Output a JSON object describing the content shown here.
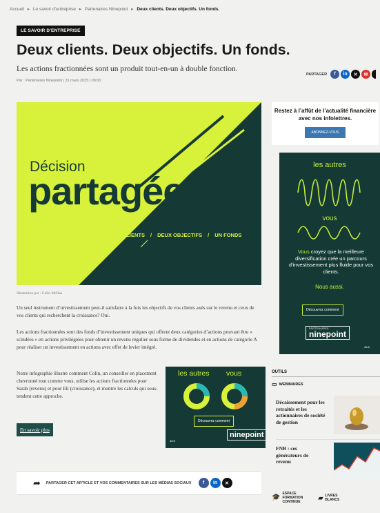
{
  "breadcrumb": {
    "items": [
      "Accueil",
      "Le savoir d’entreprise",
      "Partenaires Ninepoint"
    ],
    "current": "Deux clients. Deux objectifs. Un fonds."
  },
  "article": {
    "category": "LE SAVOIR D’ENTREPRISE",
    "title": "Deux clients. Deux objectifs. Un fonds.",
    "subtitle": "Les actions fractionnées sont un produit tout-en-un à double fonction.",
    "meta": "Par : Partenaires Ninepoint  |  31 mars 2025  |  08:00",
    "share_label": "PARTAGER",
    "caption": "Illustration par : Colin McRae",
    "paragraphs": [
      "Un seul instrument d’investissement peut-il satisfaire à la fois les objectifs de vos clients axés sur le revenu et ceux de vos clients qui recherchent la croissance? Oui.",
      "Les actions fractionnées sont des fonds d’investissement uniques qui offrent deux catégories d’actions pouvant être « scindées » en actions privilégiées pour obtenir un revenu régulier sous forme de dividendes et en actions de catégorie A pour réaliser un investissement en actions avec effet de levier intégré.",
      "Notre infographie illustre comment Colin, un conseiller en placement chevronné tout comme vous, utilise les actions fractionnées pour Sarah (revenu) et pour Eli (croissance), et montre les calculs qui sous-tendent cette approche."
    ],
    "more_button": "En savoir plus",
    "share_bar": "PARTAGER CET ARTICLE ET VOS COMMENTAIRES SUR LES MÉDIAS SOCIAUX"
  },
  "hero": {
    "word1": "Décision",
    "word2": "partagée",
    "tags": [
      "DEUX CLIENTS",
      "DEUX OBJECTIFS",
      "UN FONDS"
    ]
  },
  "newsletter": {
    "text": "Restez à l’affût de l’actualité financière avec nos infolettres.",
    "button": "ABONNEZ-VOUS"
  },
  "ad_main": {
    "top": "les autres",
    "mid": "vous",
    "body_highlight": "Vous",
    "body": " croyez que la meilleure diversification crée un parcours d’investissement plus fluide pour vos clients.",
    "also": "Nous aussi.",
    "button": "Découvrez comment",
    "brand_small": "PARTENAIRES",
    "brand": "ninepoint",
    "corner": "dérit"
  },
  "ad_inline": {
    "left": "les autres",
    "right": "vous",
    "button": "Découvrez comment",
    "brand": "ninepoint",
    "corner": "dérit"
  },
  "sidebar": {
    "tools_label": "OUTILS",
    "webinars_label": "WEBINAIRES",
    "items": [
      "Décaissement pour les retraités et les actionnaires de société de gestion",
      "FNB : ces générateurs de revenu"
    ],
    "links": [
      "ESPACE FORMATION CONTINUE",
      "LIVRES BLANCS"
    ]
  },
  "colors": {
    "lime": "#d8f13a",
    "dark_green": "#153a35",
    "facebook": "#3b5998",
    "linkedin": "#0a66c2",
    "x": "#111111",
    "email": "#d9342b"
  }
}
